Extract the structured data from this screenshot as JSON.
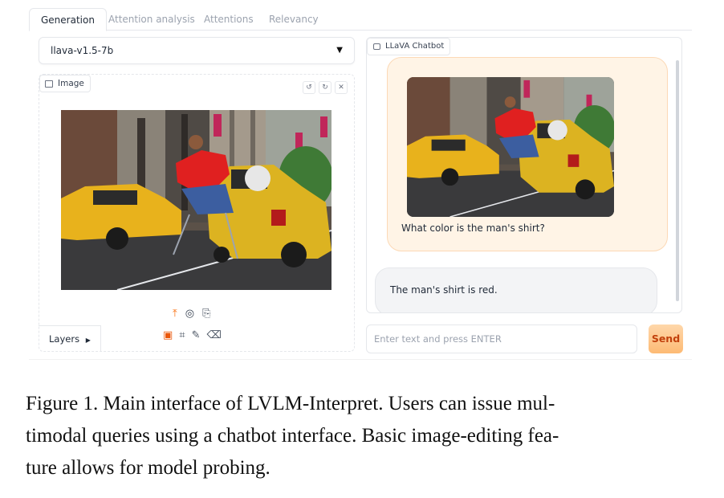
{
  "tabs": [
    "Generation",
    "Attention analysis",
    "Attentions",
    "Relevancy"
  ],
  "model_select": {
    "value": "llava-v1.5-7b"
  },
  "image_panel": {
    "label": "Image",
    "actions": [
      "undo",
      "redo",
      "close"
    ],
    "layers_label": "Layers"
  },
  "chat": {
    "label": "LLaVA Chatbot",
    "user_message": "What color is the man's shirt?",
    "bot_message": "The man's shirt is red."
  },
  "input": {
    "placeholder": "Enter text and press ENTER",
    "send_label": "Send"
  },
  "caption": {
    "lines": [
      "Figure 1. Main interface of LVLM-Interpret. Users can issue mul-",
      "timodal queries using a chatbot interface. Basic image-editing fea-",
      "ture allows for model probing."
    ]
  },
  "colors": {
    "accent": "#f97316",
    "user_bubble": "#fff4e6",
    "bot_bubble": "#f3f4f6"
  },
  "icons": {
    "upload": "upload-icon",
    "webcam": "webcam-icon",
    "clipboard": "clipboard-icon",
    "image": "image-icon",
    "crop": "crop-icon",
    "brush": "brush-icon",
    "eraser": "eraser-icon"
  }
}
